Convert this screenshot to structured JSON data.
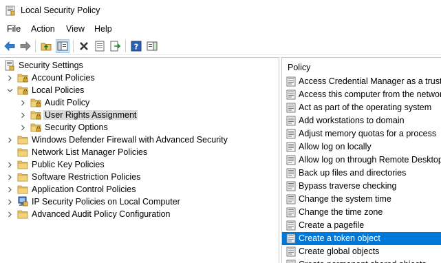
{
  "window": {
    "title": "Local Security Policy"
  },
  "menu": [
    "File",
    "Action",
    "View",
    "Help"
  ],
  "toolbar": {
    "buttons": [
      "back-icon",
      "forward-icon",
      "up-folder-icon",
      "show-hide-tree-icon",
      "delete-icon",
      "properties-icon",
      "export-list-icon",
      "help-icon",
      "show-action-pane-icon"
    ]
  },
  "tree": {
    "root": "Security Settings",
    "items": [
      {
        "label": "Account Policies",
        "level": 1,
        "expander": "collapsed"
      },
      {
        "label": "Local Policies",
        "level": 1,
        "expander": "expanded"
      },
      {
        "label": "Audit Policy",
        "level": 2,
        "expander": "collapsed"
      },
      {
        "label": "User Rights Assignment",
        "level": 2,
        "expander": "collapsed",
        "selected": true
      },
      {
        "label": "Security Options",
        "level": 2,
        "expander": "collapsed"
      },
      {
        "label": "Windows Defender Firewall with Advanced Security",
        "level": 1,
        "expander": "collapsed"
      },
      {
        "label": "Network List Manager Policies",
        "level": 1,
        "expander": "none"
      },
      {
        "label": "Public Key Policies",
        "level": 1,
        "expander": "collapsed"
      },
      {
        "label": "Software Restriction Policies",
        "level": 1,
        "expander": "collapsed"
      },
      {
        "label": "Application Control Policies",
        "level": 1,
        "expander": "collapsed"
      },
      {
        "label": "IP Security Policies on Local Computer",
        "level": 1,
        "expander": "collapsed"
      },
      {
        "label": "Advanced Audit Policy Configuration",
        "level": 1,
        "expander": "collapsed"
      }
    ]
  },
  "list": {
    "column_header": "Policy",
    "items": [
      "Access Credential Manager as a trusted caller",
      "Access this computer from the network",
      "Act as part of the operating system",
      "Add workstations to domain",
      "Adjust memory quotas for a process",
      "Allow log on locally",
      "Allow log on through Remote Desktop Services",
      "Back up files and directories",
      "Bypass traverse checking",
      "Change the system time",
      "Change the time zone",
      "Create a pagefile",
      "Create a token object",
      "Create global objects",
      "Create permanent shared objects"
    ],
    "selected_index": 12
  },
  "colors": {
    "selection": "#0078d7",
    "tree_selection": "#d9d9d9",
    "folder": "#e8c46a"
  }
}
